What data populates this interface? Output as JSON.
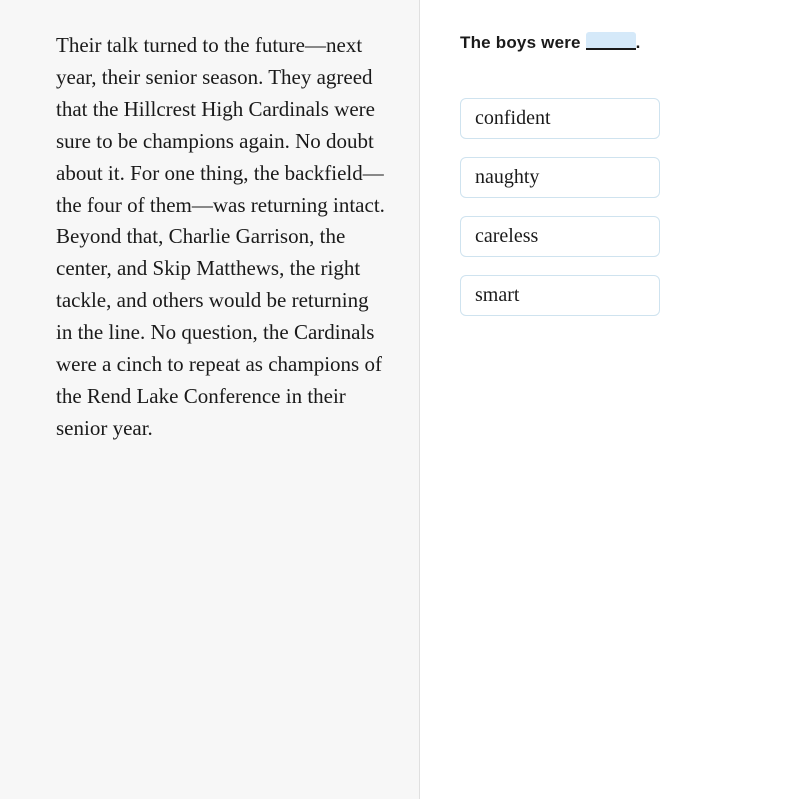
{
  "passage": "Their talk turned to the future—next year, their senior season. They agreed that the Hillcrest High Cardinals were sure to be champions again. No doubt about it. For one thing, the backfield—the four of them—was returning intact. Beyond that, Charlie Garrison, the center, and Skip Matthews, the right tackle, and others would be returning in the line. No question, the Cardinals were a cinch to repeat as champions of the Rend Lake Conference in their senior year.",
  "question": {
    "prefix": "The boys were ",
    "suffix": "."
  },
  "answers": [
    {
      "label": "confident"
    },
    {
      "label": "naughty"
    },
    {
      "label": "careless"
    },
    {
      "label": "smart"
    }
  ]
}
